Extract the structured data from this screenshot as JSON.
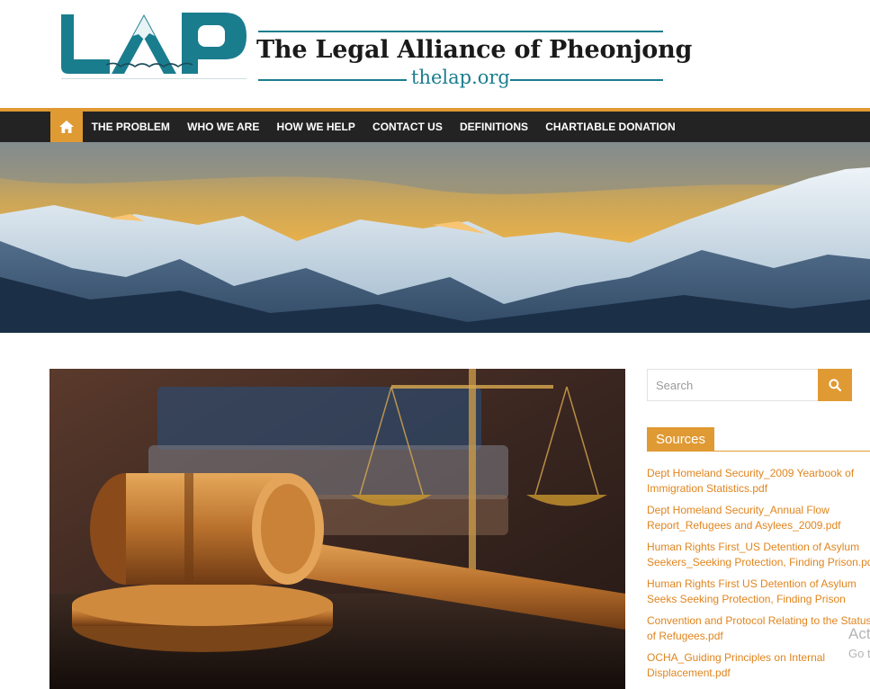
{
  "header": {
    "logo_text": "LAP",
    "site_title": "The Legal Alliance of Pheonjong",
    "site_url": "thelap.org"
  },
  "nav": {
    "home_icon": "home-icon",
    "items": [
      {
        "label": "THE PROBLEM"
      },
      {
        "label": "WHO WE ARE"
      },
      {
        "label": "HOW WE HELP"
      },
      {
        "label": "CONTACT US"
      },
      {
        "label": "DEFINITIONS"
      },
      {
        "label": "CHARTIABLE DONATION"
      }
    ]
  },
  "sidebar": {
    "search": {
      "placeholder": "Search",
      "icon": "search-icon"
    },
    "sources": {
      "heading": "Sources",
      "links": [
        [
          "Dept Homeland Security_2009 Yearbook of",
          "Immigration Statistics.pdf"
        ],
        [
          "Dept Homeland Security_Annual Flow",
          "Report_Refugees and Asylees_2009.pdf"
        ],
        [
          "Human Rights First_US Detention of Asylum",
          "Seekers_Seeking Protection, Finding Prison.pdf"
        ],
        [
          "Human Rights First US Detention of Asylum",
          "Seeks Seeking Protection, Finding Prison"
        ],
        [
          "Convention and Protocol Relating to the Status",
          "of Refugees.pdf"
        ],
        [
          "OCHA_Guiding Principles on Internal",
          "Displacement.pdf"
        ]
      ]
    }
  },
  "overlay": {
    "activate_title": "Activate Windows",
    "activate_sub": "Go to Settings to activate Windows."
  },
  "colors": {
    "accent": "#e09a33",
    "nav_bg": "#232323",
    "brand_teal": "#1a7d8e",
    "link": "#e0851e"
  }
}
